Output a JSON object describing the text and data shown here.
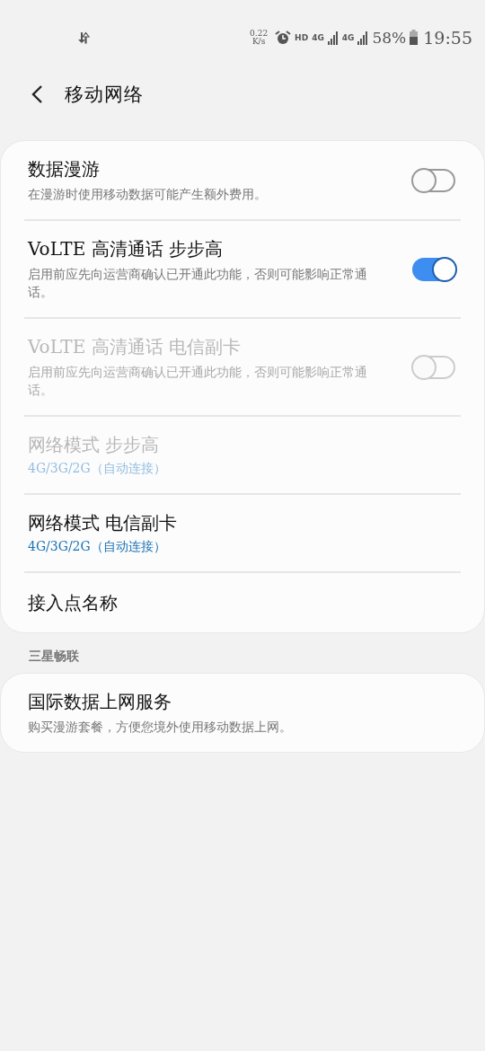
{
  "status_bar": {
    "data_speed": "0.22",
    "data_speed_unit": "K/s",
    "hd": "HD",
    "sim1_network": "4G",
    "sim2_network": "4G",
    "battery": "58%",
    "time": "19:55"
  },
  "header": {
    "title": "移动网络"
  },
  "sections": [
    {
      "items": [
        {
          "kind": "toggle",
          "title": "数据漫游",
          "subtitle": "在漫游时使用移动数据可能产生额外费用。",
          "on": false,
          "disabled": false
        },
        {
          "kind": "toggle",
          "title": "VoLTE 高清通话 步步高",
          "subtitle": "启用前应先向运营商确认已开通此功能，否则可能影响正常通话。",
          "on": true,
          "disabled": false
        },
        {
          "kind": "toggle",
          "title": "VoLTE 高清通话 电信副卡",
          "subtitle": "启用前应先向运营商确认已开通此功能，否则可能影响正常通话。",
          "on": false,
          "disabled": true
        },
        {
          "kind": "value",
          "title": "网络模式 步步高",
          "subtitle": "4G/3G/2G（自动连接）",
          "disabled": true
        },
        {
          "kind": "value",
          "title": "网络模式 电信副卡",
          "subtitle": "4G/3G/2G（自动连接）",
          "disabled": false
        },
        {
          "kind": "plain",
          "title": "接入点名称",
          "disabled": false
        }
      ]
    },
    {
      "header": "三星畅联",
      "items": [
        {
          "kind": "plain",
          "title": "国际数据上网服务",
          "subtitle": "购买漫游套餐，方便您境外使用移动数据上网。",
          "disabled": false
        }
      ]
    }
  ]
}
